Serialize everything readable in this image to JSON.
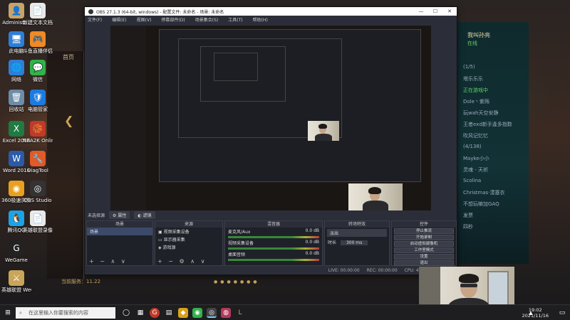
{
  "desktop": {
    "icons": [
      {
        "id": "admin",
        "label": "Administr...",
        "glyph": "👤",
        "color": "#c8a46a"
      },
      {
        "id": "new-doc",
        "label": "新建文本文档",
        "glyph": "📄",
        "color": "#e9e9e9"
      },
      {
        "id": "computer",
        "label": "此电脑",
        "glyph": "🖥",
        "color": "#2d7fd6"
      },
      {
        "id": "game-booster",
        "label": "斗鱼直播伴侣",
        "glyph": "🎮",
        "color": "#f08a24"
      },
      {
        "id": "network",
        "label": "网络",
        "glyph": "🌐",
        "color": "#2d7fd6"
      },
      {
        "id": "wechat",
        "label": "微信",
        "glyph": "💬",
        "color": "#2fb34a"
      },
      {
        "id": "recycle",
        "label": "回收站",
        "glyph": "🗑",
        "color": "#6c8ca8"
      },
      {
        "id": "pc-manager",
        "label": "电脑管家",
        "glyph": "🛡",
        "color": "#1d7be0"
      },
      {
        "id": "excel",
        "label": "Excel 2016",
        "glyph": "X",
        "color": "#1f7a43"
      },
      {
        "id": "nba2k",
        "label": "NBA2K Online",
        "glyph": "🏀",
        "color": "#c0392b"
      },
      {
        "id": "word",
        "label": "Word 2016",
        "glyph": "W",
        "color": "#2b5ba8"
      },
      {
        "id": "diagtool",
        "label": "DiagTool",
        "glyph": "🔧",
        "color": "#e05a2a"
      },
      {
        "id": "browser360",
        "label": "360极速浏览器",
        "glyph": "◉",
        "color": "#e8a020"
      },
      {
        "id": "obs",
        "label": "OBS Studio",
        "glyph": "◎",
        "color": "#333333"
      },
      {
        "id": "qq",
        "label": "腾讯QQ",
        "glyph": "🐧",
        "color": "#1aa3e8"
      },
      {
        "id": "recorder",
        "label": "英雄联盟录像回放",
        "glyph": "📄",
        "color": "#e9e9e9"
      },
      {
        "id": "wegame",
        "label": "WeGame",
        "glyph": "G",
        "color": "#222222"
      },
      {
        "id": "wegame2",
        "label": "英雄联盟 WeGame版",
        "glyph": "⚔",
        "color": "#c9a55a"
      }
    ]
  },
  "lol": {
    "home_label": "首页",
    "server_label": "当前服务：11.22",
    "user_name": "我叫孙亮",
    "user_status": "在线",
    "friend_lines": [
      "(1/5)",
      "塔乐乐乐",
      "正在游戏中",
      "Dole丶紫殇",
      "玩wah天空安静",
      "王者exd新手逢多指数",
      "吹风记忆忆",
      "(4/138)",
      "Mayke小小",
      "灵魂 - 天祈",
      "Scolina",
      "Christmas·漠塞衣",
      "不想玩嘛加GAQ",
      "发票",
      "四秒"
    ]
  },
  "obs": {
    "title": "OBS 27.1.3 (64-bit, windows) - 配置文件: 未命名 - 场景: 未命名",
    "menu": [
      "文件(F)",
      "编辑(E)",
      "视图(V)",
      "停靠部件(D)",
      "场景集合(S)",
      "工具(T)",
      "帮助(H)"
    ],
    "scene_bar_label": "未选择源",
    "properties_button": "属性",
    "filters_button": "滤镜",
    "docks": {
      "scenes": {
        "title": "场景",
        "items": [
          "场景"
        ]
      },
      "sources": {
        "title": "来源",
        "items": [
          "视频采集设备",
          "显示器采集",
          "游戏源"
        ]
      },
      "mixer": {
        "title": "混音器",
        "channels": [
          {
            "name": "麦克风/Aux",
            "value": "0.0 dB"
          },
          {
            "name": "视频采集设备",
            "value": "0.0 dB"
          },
          {
            "name": "桌面音频",
            "value": "0.0 dB"
          }
        ]
      },
      "transitions": {
        "title": "转场特效",
        "type": "淡出",
        "duration_label": "时长",
        "duration": "300 ms"
      },
      "controls": {
        "title": "控件",
        "buttons": [
          "停止推流",
          "开始录制",
          "启动虚拟摄像机",
          "工作室模式",
          "设置",
          "退出"
        ]
      }
    },
    "status": {
      "live": "LIVE: 00:00:00",
      "rec": "REC: 00:00:00",
      "cpu": "CPU: 4.1%, 30.00 fps"
    }
  },
  "taskbar": {
    "search_placeholder": "在这里输入你要搜索的内容",
    "time": "19:02",
    "date": "2021/11/16"
  },
  "colors": {
    "obs_bg": "#2b2e38",
    "lol_gold": "#c9a55a",
    "online_green": "#5fd36a"
  }
}
